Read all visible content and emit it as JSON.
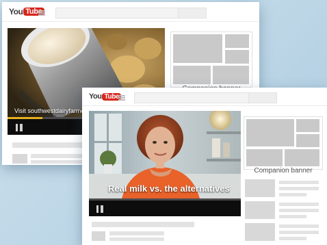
{
  "window_back": {
    "logo_word": "You",
    "logo_tube": "Tube",
    "video_caption": "Visit southwestdairyfarmers",
    "companion_label": "Companion banner",
    "progress": 0.22
  },
  "window_front": {
    "logo_word": "You",
    "logo_tube": "Tube",
    "video_caption": "Real milk vs. the alternatives",
    "companion_label": "Companion banner",
    "progress": 0.0
  },
  "colors": {
    "youtube_red": "#d7261e",
    "progress_yellow": "#e5b020",
    "placeholder_gray": "#c9c9c9"
  },
  "icons": [
    "hamburger-menu-icon",
    "pause-icon"
  ]
}
